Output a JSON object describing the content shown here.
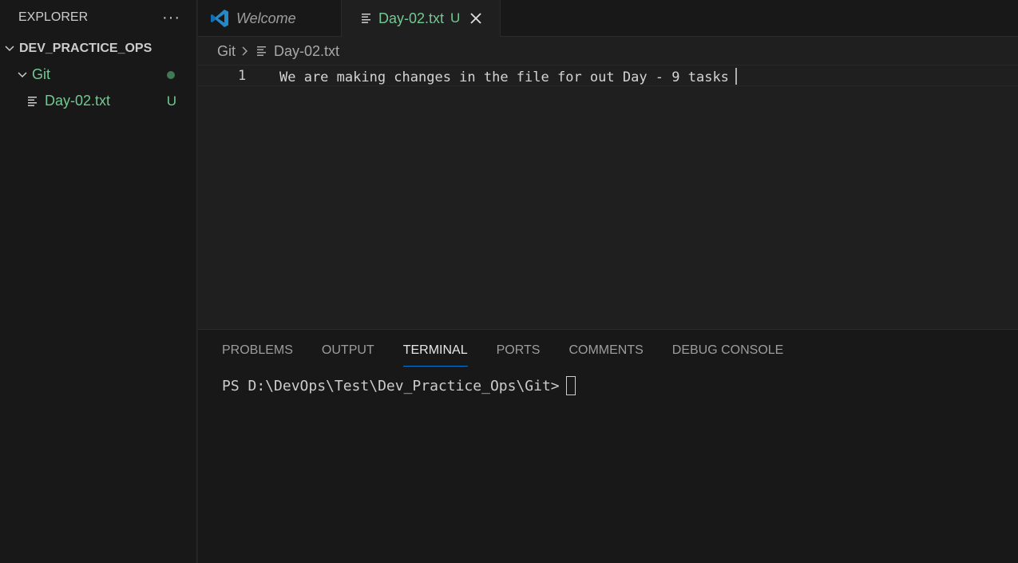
{
  "sidebar": {
    "title": "EXPLORER",
    "more_label": "···",
    "root": "DEV_PRACTICE_OPS",
    "folder": {
      "name": "Git",
      "status": "modified-dot"
    },
    "file": {
      "name": "Day-02.txt",
      "status": "U"
    }
  },
  "tabs": [
    {
      "label": "Welcome",
      "icon": "vscode-icon"
    },
    {
      "label": "Day-02.txt",
      "status": "U",
      "icon": "text-file-icon"
    }
  ],
  "breadcrumb": {
    "folder": "Git",
    "file": "Day-02.txt"
  },
  "editor": {
    "line_number": "1",
    "line_text": "We are making changes in the file for out Day - 9 tasks"
  },
  "panel": {
    "tabs": [
      "PROBLEMS",
      "OUTPUT",
      "TERMINAL",
      "PORTS",
      "COMMENTS",
      "DEBUG CONSOLE"
    ],
    "active_tab": "TERMINAL",
    "terminal_prompt": "PS D:\\DevOps\\Test\\Dev_Practice_Ops\\Git>"
  },
  "colors": {
    "accent": "#0078d4",
    "untracked": "#73c991",
    "background": "#1f1f1f",
    "sidebar": "#181818"
  }
}
